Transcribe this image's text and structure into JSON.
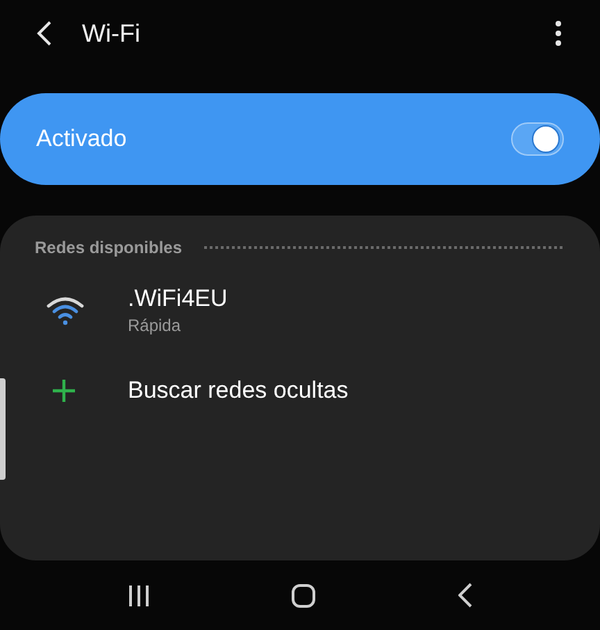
{
  "header": {
    "title": "Wi-Fi"
  },
  "master_switch": {
    "label": "Activado",
    "on": true
  },
  "networks_section": {
    "title": "Redes disponibles",
    "items": [
      {
        "kind": "network",
        "name": ".WiFi4EU",
        "detail": "Rápida"
      },
      {
        "kind": "add",
        "name": "Buscar redes ocultas"
      }
    ]
  }
}
